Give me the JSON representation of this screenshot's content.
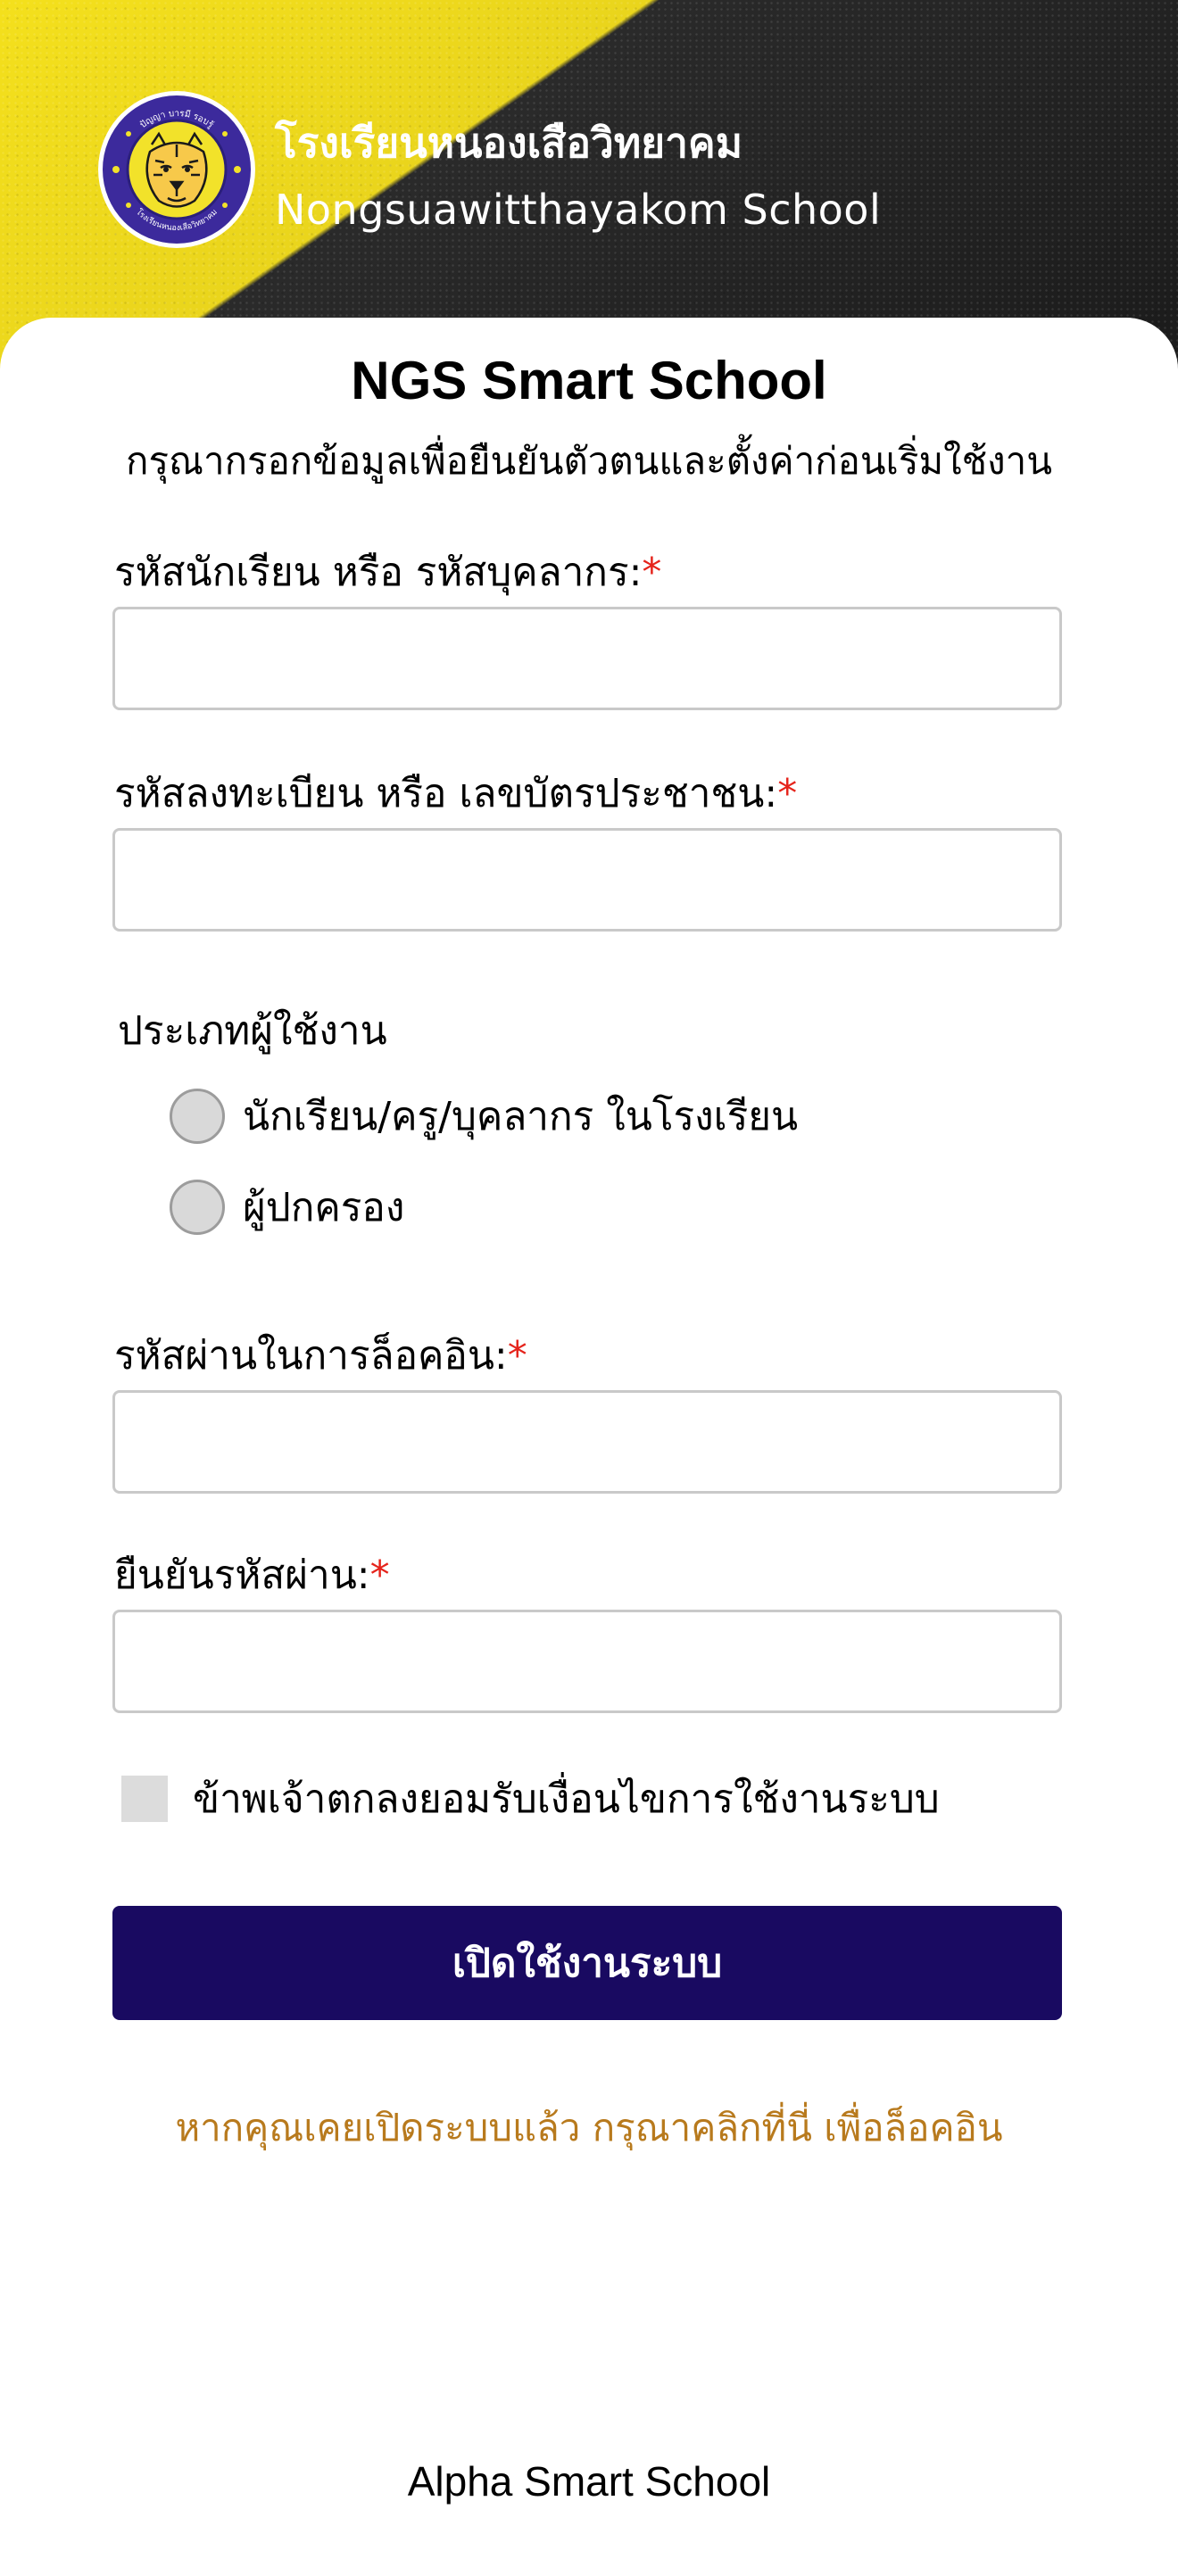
{
  "header": {
    "school_name_th": "โรงเรียนหนองเสือวิทยาคม",
    "school_name_en": "Nongsuawitthayakom School",
    "logo_icon": "tiger-emblem-icon",
    "logo_top_text": "ปัญญา บารมี รอบรู้",
    "logo_bottom_text": "โรงเรียนหนองเสือวิทยาคม",
    "colors": {
      "yellow": "#f4e01c",
      "dark": "#1b1b1b"
    }
  },
  "form": {
    "title": "NGS Smart School",
    "subtitle": "กรุณากรอกข้อมูลเพื่อยืนยันตัวตนและตั้งค่าก่อนเริ่มใช้งาน",
    "required_mark": "*",
    "fields": {
      "user_id": {
        "label": "รหัสนักเรียน หรือ รหัสบุคลากร:",
        "value": "",
        "placeholder": ""
      },
      "reg_id": {
        "label": "รหัสลงทะเบียน หรือ เลขบัตรประชาชน:",
        "value": "",
        "placeholder": ""
      },
      "password": {
        "label": "รหัสผ่านในการล็อคอิน:",
        "value": "",
        "placeholder": ""
      },
      "confirm_password": {
        "label": "ยืนยันรหัสผ่าน:",
        "value": "",
        "placeholder": ""
      }
    },
    "user_type": {
      "label": "ประเภทผู้ใช้งาน",
      "options": [
        {
          "label": "นักเรียน/ครู/บุคลากร ในโรงเรียน",
          "selected": false
        },
        {
          "label": "ผู้ปกครอง",
          "selected": false
        }
      ]
    },
    "terms": {
      "label": "ข้าพเจ้าตกลงยอมรับเงื่อนไขการใช้งานระบบ",
      "checked": false
    },
    "submit_label": "เปิดใช้งานระบบ",
    "login_link": "หากคุณเคยเปิดระบบแล้ว กรุณาคลิกที่นี่ เพื่อล็อคอิน",
    "colors": {
      "button": "#190a61",
      "link": "#b87a1d",
      "required": "#e5231b"
    }
  },
  "footer": {
    "text": "Alpha Smart School"
  }
}
